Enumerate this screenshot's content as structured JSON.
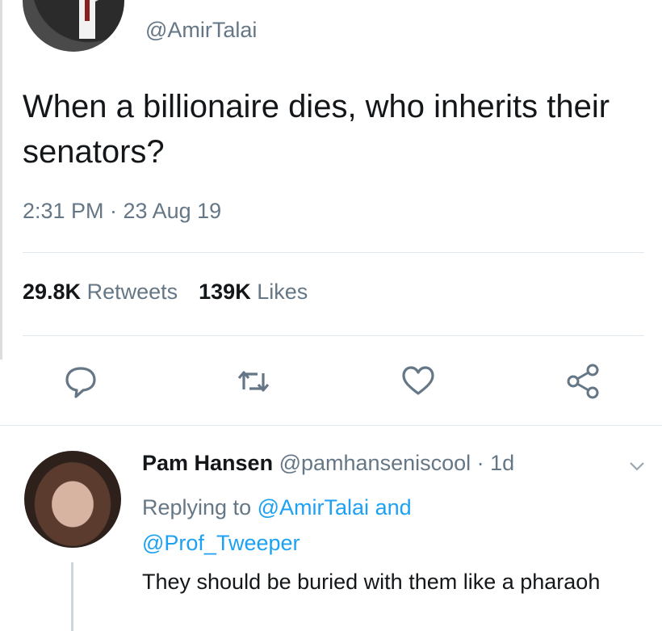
{
  "tweet": {
    "handle": "@AmirTalai",
    "text": "When a billionaire dies, who inherits their senators?",
    "timestamp": "2:31 PM · 23 Aug 19",
    "retweets_count": "29.8K",
    "retweets_label": "Retweets",
    "likes_count": "139K",
    "likes_label": "Likes"
  },
  "actions": [
    "reply-icon",
    "retweet-icon",
    "like-icon",
    "share-icon"
  ],
  "reply": {
    "name": "Pam Hansen",
    "handle": "@pamhanseniscool",
    "time": "· 1d",
    "replying_prefix": "Replying to",
    "replying_user1": "@AmirTalai",
    "replying_and": "and",
    "replying_user2": "@Prof_Tweeper",
    "text": "They should be buried with them like a pharaoh"
  },
  "colors": {
    "secondary_text": "#657786",
    "link": "#1da1f2",
    "divider": "#e1e8ed"
  }
}
